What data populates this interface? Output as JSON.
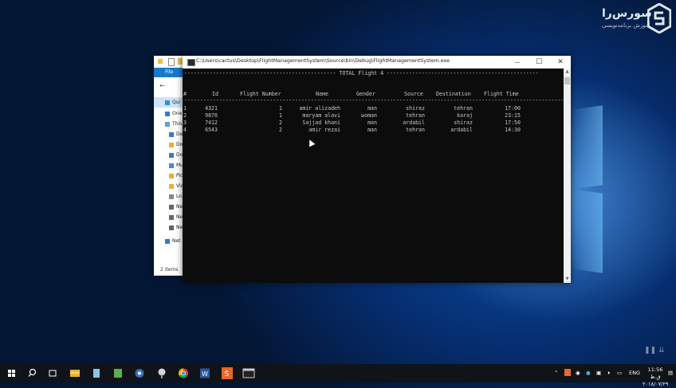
{
  "brand": {
    "name": "سورس‌را",
    "tagline": "آموزش برنامه‌نویسی"
  },
  "explorer": {
    "file_tab": "File",
    "nav": [
      "Qui",
      "One",
      "This",
      "De",
      "Do",
      "Do",
      "Mu",
      "Pic",
      "Vic",
      "Lo",
      "Ne",
      "Ne",
      "Ne",
      "Net"
    ],
    "status": "2 items"
  },
  "console": {
    "title": "C:\\Users\\cactus\\Desktop\\FlightManagementSystem\\Source\\bin\\Debug\\FlightManagementSystem.exe",
    "banner": "------------------------------------------------ TOTAL Flight 4 ------------------------------------------------",
    "separator": "-------------------------------------------------------------------------------------------------------------------------",
    "headers": [
      "#",
      "Id",
      "Flight Number",
      "Name",
      "Gender",
      "Source",
      "Destination",
      "Flight Time"
    ],
    "rows": [
      [
        "1",
        "4321",
        "1",
        "amir alizadeh",
        "man",
        "shiraz",
        "tehran",
        "17:00"
      ],
      [
        "2",
        "9876",
        "1",
        "maryam alavi",
        "woman",
        "tehran",
        "karaj",
        "23:15"
      ],
      [
        "3",
        "7412",
        "2",
        "Sajjad khani",
        "man",
        "ardabil",
        "shiraz",
        "17:50"
      ],
      [
        "4",
        "6543",
        "2",
        "amir rezai",
        "man",
        "tehran",
        "ardabil",
        "14:30"
      ]
    ],
    "minimize": "—",
    "maximize": "☐",
    "close": "✕"
  },
  "tray": {
    "lang": "ENG",
    "time": "11:56 ق.ظ",
    "date": "۲۰۱۸/۰۷/۲۹"
  },
  "colors": {
    "console_bg": "#0c0c0c",
    "taskbar": "#101418",
    "accent": "#1979ca"
  }
}
